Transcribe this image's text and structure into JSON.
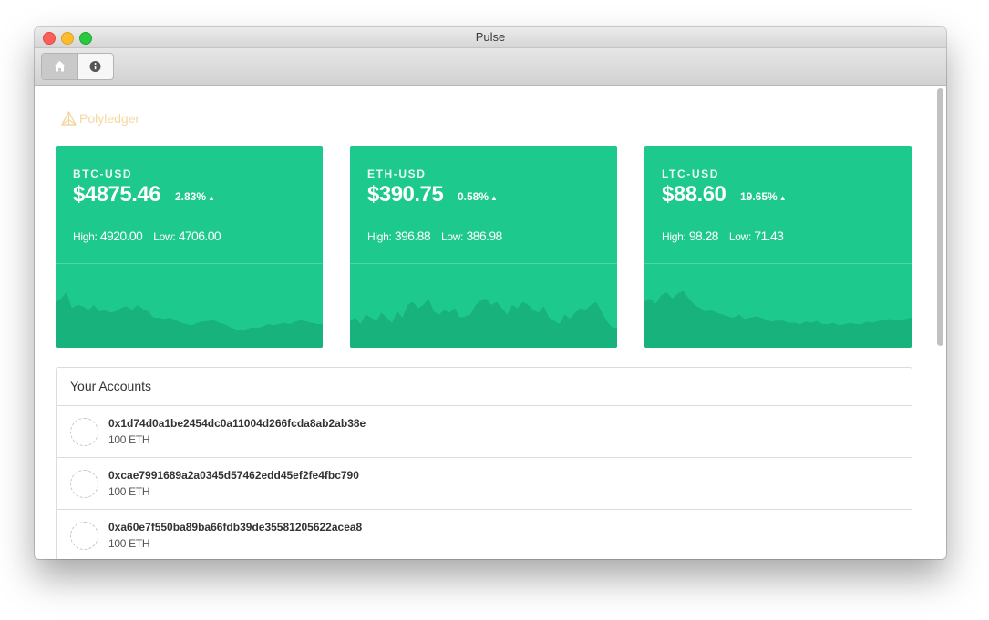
{
  "window": {
    "title": "Pulse"
  },
  "toolbar": {
    "home_icon": "home-icon",
    "info_icon": "info-icon"
  },
  "brand": {
    "name": "Polyledger",
    "icon": "polyledger-logo-icon",
    "color": "#f4d8a2"
  },
  "colors": {
    "card_bg": "#1dc98d",
    "chart_fill": "#18b27c",
    "text_dark": "#333333"
  },
  "tickers": [
    {
      "label": "BTC-USD",
      "price": "$4875.46",
      "change": "2.83%",
      "direction": "up",
      "high_label": "High:",
      "high": "4920.00",
      "low_label": "Low:",
      "low": "4706.00",
      "sparkline": [
        0.55,
        0.6,
        0.7,
        0.45,
        0.5,
        0.48,
        0.42,
        0.5,
        0.4,
        0.42,
        0.38,
        0.4,
        0.45,
        0.48,
        0.42,
        0.5,
        0.44,
        0.4,
        0.3,
        0.3,
        0.28,
        0.3,
        0.26,
        0.22,
        0.2,
        0.18,
        0.22,
        0.24,
        0.25,
        0.26,
        0.22,
        0.2,
        0.15,
        0.12,
        0.1,
        0.12,
        0.15,
        0.14,
        0.16,
        0.2,
        0.18,
        0.2,
        0.22,
        0.2,
        0.24,
        0.26,
        0.24,
        0.22,
        0.2,
        0.2
      ]
    },
    {
      "label": "ETH-USD",
      "price": "$390.75",
      "change": "0.58%",
      "direction": "up",
      "high_label": "High:",
      "high": "396.88",
      "low_label": "Low:",
      "low": "386.98",
      "sparkline": [
        0.25,
        0.3,
        0.2,
        0.35,
        0.3,
        0.25,
        0.38,
        0.3,
        0.22,
        0.4,
        0.3,
        0.5,
        0.55,
        0.45,
        0.5,
        0.6,
        0.4,
        0.35,
        0.42,
        0.38,
        0.45,
        0.3,
        0.32,
        0.35,
        0.5,
        0.58,
        0.6,
        0.5,
        0.55,
        0.45,
        0.35,
        0.5,
        0.45,
        0.55,
        0.5,
        0.42,
        0.38,
        0.48,
        0.3,
        0.25,
        0.2,
        0.35,
        0.28,
        0.38,
        0.45,
        0.42,
        0.5,
        0.55,
        0.4,
        0.25,
        0.15,
        0.14
      ]
    },
    {
      "label": "LTC-USD",
      "price": "$88.60",
      "change": "19.65%",
      "direction": "up",
      "high_label": "High:",
      "high": "98.28",
      "low_label": "Low:",
      "low": "71.43",
      "sparkline": [
        0.55,
        0.6,
        0.52,
        0.65,
        0.7,
        0.6,
        0.68,
        0.72,
        0.6,
        0.5,
        0.45,
        0.4,
        0.42,
        0.38,
        0.35,
        0.32,
        0.3,
        0.35,
        0.28,
        0.3,
        0.32,
        0.3,
        0.26,
        0.24,
        0.26,
        0.25,
        0.22,
        0.22,
        0.2,
        0.24,
        0.22,
        0.25,
        0.2,
        0.2,
        0.22,
        0.18,
        0.2,
        0.22,
        0.2,
        0.2,
        0.24,
        0.22,
        0.25,
        0.26,
        0.28,
        0.25,
        0.26,
        0.28,
        0.3
      ]
    }
  ],
  "accounts": {
    "title": "Your Accounts",
    "items": [
      {
        "address": "0x1d74d0a1be2454dc0a11004d266fcda8ab2ab38e",
        "balance": "100 ETH"
      },
      {
        "address": "0xcae7991689a2a0345d57462edd45ef2fe4fbc790",
        "balance": "100 ETH"
      },
      {
        "address": "0xa60e7f550ba89ba66fdb39de35581205622acea8",
        "balance": "100 ETH"
      }
    ]
  }
}
